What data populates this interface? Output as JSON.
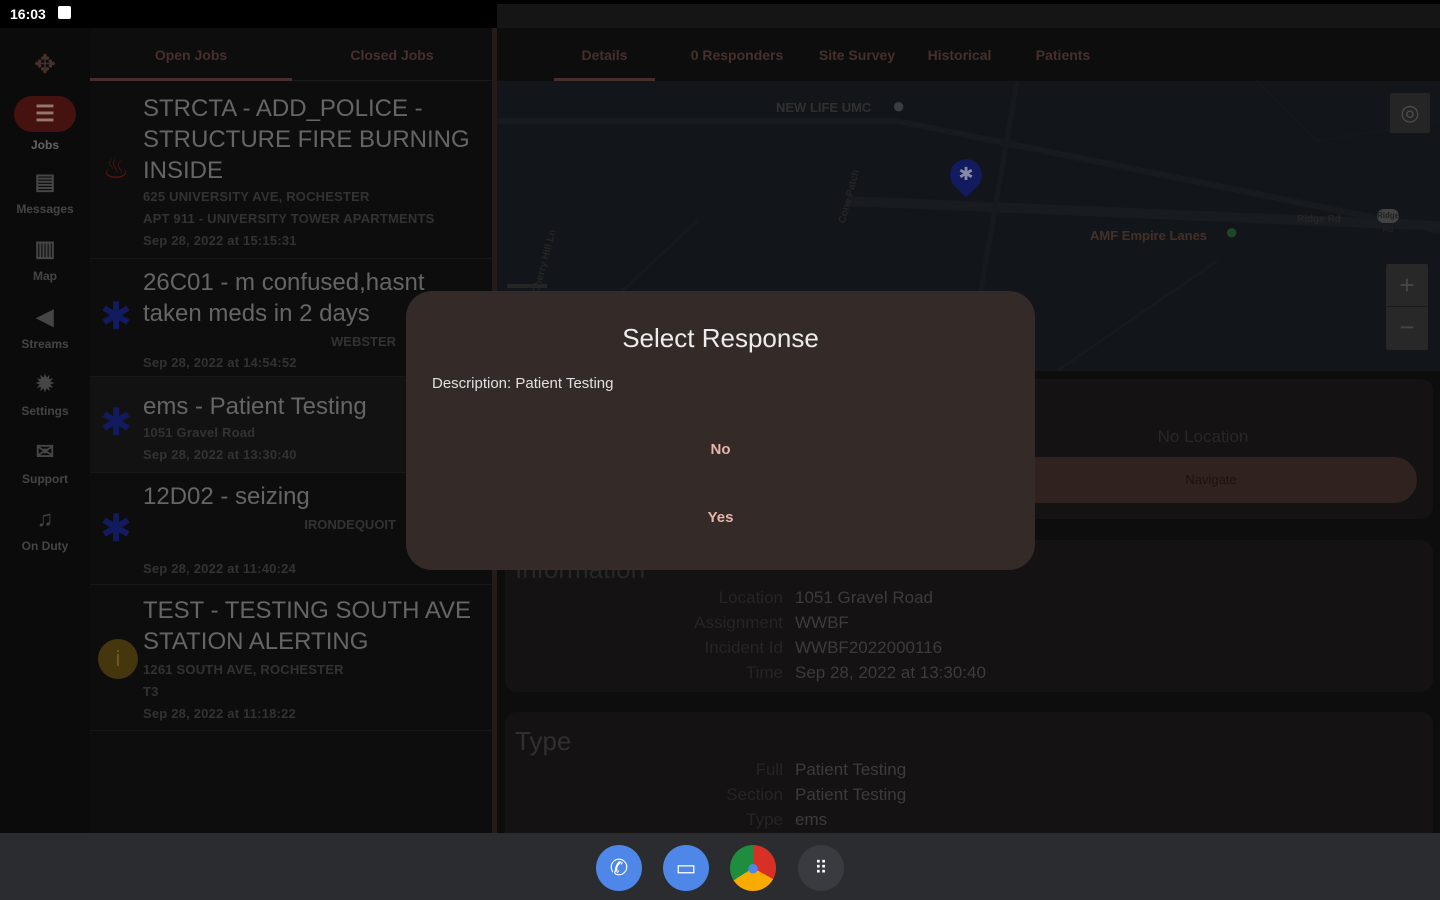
{
  "status_bar": {
    "time": "16:03"
  },
  "rail": {
    "items": [
      {
        "label": "Jobs"
      },
      {
        "label": "Messages"
      },
      {
        "label": "Map"
      },
      {
        "label": "Streams"
      },
      {
        "label": "Settings"
      },
      {
        "label": "Support"
      },
      {
        "label": "On Duty"
      }
    ]
  },
  "jobs_panel": {
    "tabs": [
      "Open Jobs",
      "Closed Jobs"
    ],
    "jobs": [
      {
        "title": "STRCTA - ADD_POLICE - STRUCTURE FIRE BURNING INSIDE",
        "line1": "625 UNIVERSITY AVE, ROCHESTER",
        "line2": "APT 911 - UNIVERSITY TOWER APARTMENTS",
        "time": "Sep 28, 2022 at 15:15:31",
        "icon": "flame-icon"
      },
      {
        "title": "26C01 - m confused,hasnt taken meds in 2 days",
        "line1": "WEBSTER",
        "time": "Sep 28, 2022 at 14:54:52",
        "icon": "star-of-life-icon"
      },
      {
        "title": "ems - Patient Testing",
        "line1": "1051 Gravel Road",
        "time": "Sep 28, 2022 at 13:30:40",
        "icon": "star-of-life-icon"
      },
      {
        "title": "12D02 - seizing",
        "line1": "IRONDEQUOIT",
        "time": "Sep 28, 2022 at 11:40:24",
        "icon": "star-of-life-icon"
      },
      {
        "title": "TEST - TESTING SOUTH AVE STATION ALERTING",
        "line1": "1261 SOUTH AVE, ROCHESTER",
        "line2": "T3",
        "time": "Sep 28, 2022 at 11:18:22",
        "icon": "info-icon"
      }
    ]
  },
  "details_panel": {
    "tabs": [
      "Details",
      "0 Responders",
      "Site Survey",
      "Historical",
      "Patients"
    ],
    "map": {
      "labels": {
        "poi1": "NEW LIFE UMC",
        "poi2": "AMF Empire Lanes",
        "road1": "Cherry Hill Ln",
        "road2": "Cone Patch",
        "road3": "Ridge Rd",
        "road4": "Ridge Rd"
      },
      "zoom_in": "+",
      "zoom_out": "−"
    },
    "location_card": {
      "text": "No Location",
      "button": "Navigate"
    },
    "info_card": {
      "heading": "Information",
      "rows": [
        {
          "key": "Location",
          "value": "1051 Gravel Road"
        },
        {
          "key": "Assignment",
          "value": "WWBF"
        },
        {
          "key": "Incident Id",
          "value": "WWBF2022000116"
        },
        {
          "key": "Time",
          "value": "Sep 28, 2022 at 13:30:40"
        }
      ]
    },
    "type_card": {
      "heading": "Type",
      "rows": [
        {
          "key": "Full",
          "value": "Patient Testing"
        },
        {
          "key": "Section",
          "value": "Patient Testing"
        },
        {
          "key": "Type",
          "value": "ems"
        }
      ]
    }
  },
  "dialog": {
    "title": "Select Response",
    "description": "Description: Patient Testing",
    "options": [
      "No",
      "Yes"
    ]
  },
  "colors": {
    "accent": "#6a4a44",
    "dialog_bg": "#342a28",
    "option_text": "#e9b4a9",
    "ems_blue": "#1b2a8f",
    "fire_red": "#8a1d16"
  }
}
